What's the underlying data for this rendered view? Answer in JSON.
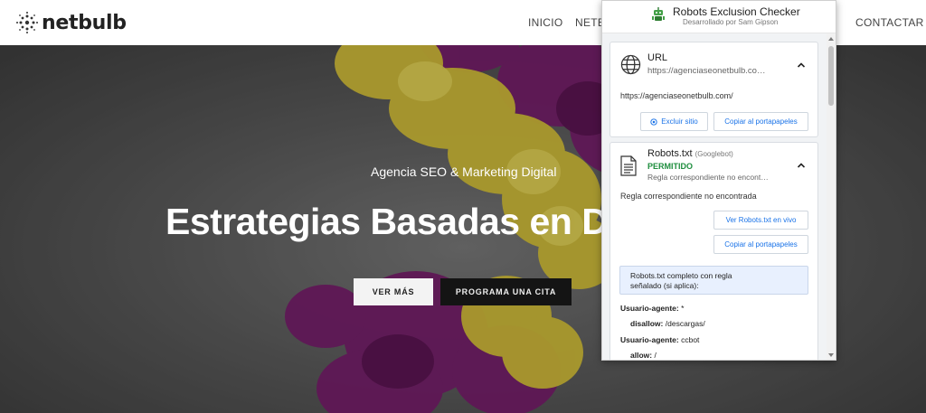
{
  "site": {
    "logo_text": "netbulb",
    "nav": [
      "INICIO",
      "NETB",
      "CONTACTAR"
    ]
  },
  "hero": {
    "kicker": "Agencia SEO & Marketing Digital",
    "title": "Estrategias Basadas en Da",
    "primary_button": "VER MÁS",
    "secondary_button": "PROGRAMA UNA CITA"
  },
  "extension": {
    "title": "Robots Exclusion Checker",
    "subtitle": "Desarrollado por Sam Gipson",
    "url_card": {
      "title": "URL",
      "url_truncated": "https://agenciaseonetbulb.co…",
      "url_full": "https://agenciaseonetbulb.com/",
      "exclude_button": "Excluir sitio",
      "copy_button": "Copiar al portapapeles"
    },
    "robots_card": {
      "title": "Robots.txt",
      "agent": "(Googlebot)",
      "status": "PERMITIDO",
      "rule_truncated": "Regla correspondiente no encont…",
      "rule_full": "Regla correspondiente no encontrada",
      "live_button": "Ver Robots.txt en vivo",
      "copy_button": "Copiar al portapapeles",
      "info_line1": "Robots.txt completo con regla",
      "info_line2": "señalado (si aplica):",
      "rules": [
        {
          "key": "Usuario-agente:",
          "value": "*"
        },
        {
          "key": "disallow:",
          "value": "/descargas/"
        },
        {
          "key": "Usuario-agente:",
          "value": "ccbot"
        },
        {
          "key": "allow:",
          "value": "/"
        }
      ]
    }
  },
  "colors": {
    "allowed_green": "#1e8e3e",
    "link_blue": "#1a73e8",
    "info_bg": "#e8f0fe"
  },
  "icons": [
    "netbulb-logo-icon",
    "robot-icon",
    "globe-icon",
    "document-icon",
    "chevron-up-icon",
    "exclude-icon"
  ]
}
